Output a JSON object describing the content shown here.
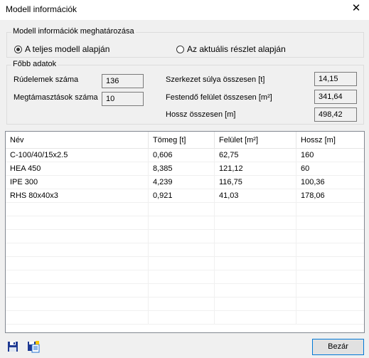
{
  "window": {
    "title": "Modell információk",
    "close_glyph": "✕"
  },
  "def_group": {
    "legend": "Modell információk meghatározása",
    "options": [
      {
        "label": "A teljes modell alapján",
        "checked": true
      },
      {
        "label": "Az aktuális részlet alapján",
        "checked": false
      }
    ]
  },
  "main_group": {
    "legend": "Főbb adatok",
    "beam_count_label": "Rúdelemek száma",
    "beam_count_value": "136",
    "support_count_label": "Megtámasztások száma",
    "support_count_value": "10",
    "weight_label": "Szerkezet súlya összesen [t]",
    "weight_value": "14,15",
    "paint_label": "Festendő felület összesen [m²]",
    "paint_value": "341,64",
    "length_label": "Hossz összesen [m]",
    "length_value": "498,42"
  },
  "table": {
    "columns": [
      "Név",
      "Tömeg [t]",
      "Felület [m²]",
      "Hossz [m]"
    ],
    "rows": [
      [
        "C-100/40/15x2.5",
        "0,606",
        "62,75",
        "160"
      ],
      [
        "HEA 450",
        "8,385",
        "121,12",
        "60"
      ],
      [
        "IPE 300",
        "4,239",
        "116,75",
        "100,36"
      ],
      [
        "RHS 80x40x3",
        "0,921",
        "41,03",
        "178,06"
      ]
    ]
  },
  "footer": {
    "save_icon": "save-icon",
    "export_icon": "export-icon",
    "close_label": "Bezár"
  }
}
